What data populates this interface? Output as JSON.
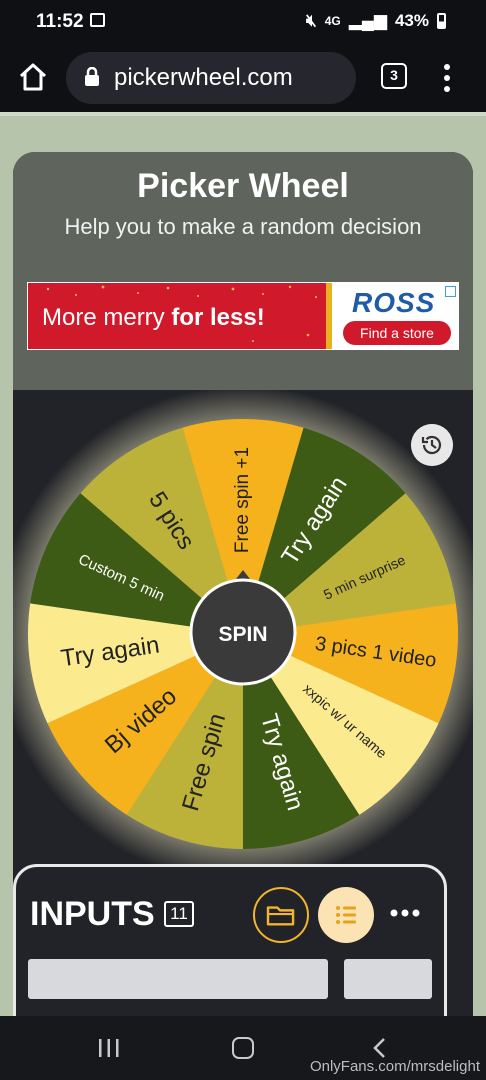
{
  "status": {
    "time": "11:52",
    "network": "4G",
    "battery": "43%"
  },
  "browser": {
    "url": "pickerwheel.com",
    "tab_count": "3"
  },
  "header": {
    "title": "Picker Wheel",
    "subtitle": "Help you to make a random decision"
  },
  "ad": {
    "text_regular": "More merry ",
    "text_bold": "for less!",
    "brand": "ROSS",
    "cta": "Find a store"
  },
  "wheel": {
    "spin_label": "SPIN",
    "segments": [
      {
        "label": "Free spin +1",
        "color": "#f5b21d",
        "size": 19
      },
      {
        "label": "Try again",
        "color": "#3d5b14",
        "size": 24
      },
      {
        "label": "5 min surprise",
        "color": "#bcb23a",
        "size": 14
      },
      {
        "label": "3 pics 1 video",
        "color": "#f5b21d",
        "size": 20
      },
      {
        "label": "xxpic w/ ur name",
        "color": "#fcea8e",
        "size": 14
      },
      {
        "label": "Try again",
        "color": "#3d5b14",
        "size": 24
      },
      {
        "label": "Free spin",
        "color": "#bcb23a",
        "size": 24
      },
      {
        "label": "Bj video",
        "color": "#f5b21d",
        "size": 24
      },
      {
        "label": "Try again",
        "color": "#fcea8e",
        "size": 24
      },
      {
        "label": "Custom 5 min",
        "color": "#3d5b14",
        "size": 15
      },
      {
        "label": "5 pics",
        "color": "#bcb23a",
        "size": 24
      }
    ]
  },
  "inputs": {
    "title": "INPUTS",
    "count": "11"
  },
  "watermark": "OnlyFans.com/mrsdelight"
}
